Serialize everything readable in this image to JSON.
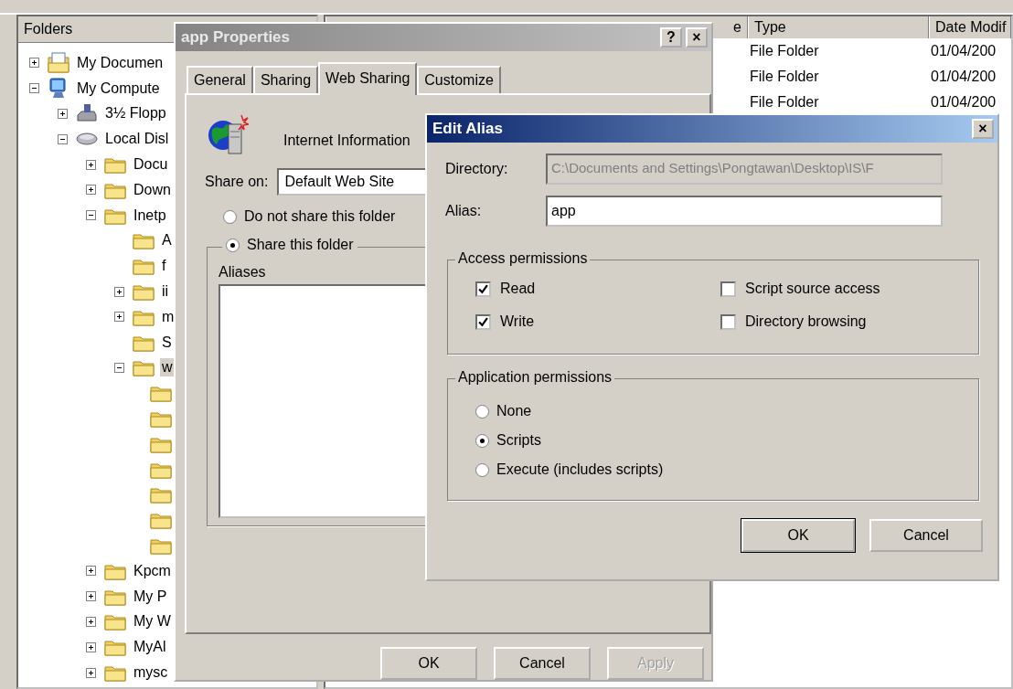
{
  "explorer": {
    "folders_title": "Folders",
    "tree": [
      {
        "label": "My Documen",
        "kind": "documents",
        "expanded": false,
        "selected": false
      },
      {
        "label": "My Compute",
        "kind": "computer",
        "expanded": true,
        "selected": false,
        "children": [
          {
            "label": "3½ Flopp",
            "kind": "floppy",
            "expanded": false,
            "selected": false
          },
          {
            "label": "Local Disl",
            "kind": "disk",
            "expanded": true,
            "selected": false,
            "children": [
              {
                "label": "Docu",
                "kind": "folder",
                "expanded": false,
                "selected": false
              },
              {
                "label": "Down",
                "kind": "folder",
                "expanded": false,
                "selected": false
              },
              {
                "label": "Inetp",
                "kind": "folder",
                "expanded": true,
                "selected": false,
                "children": [
                  {
                    "label": "A",
                    "kind": "folder",
                    "selected": false
                  },
                  {
                    "label": "f",
                    "kind": "folder",
                    "selected": false
                  },
                  {
                    "label": "ii",
                    "kind": "folder",
                    "expanded": false,
                    "selected": false
                  },
                  {
                    "label": "m",
                    "kind": "folder",
                    "expanded": false,
                    "selected": false
                  },
                  {
                    "label": "S",
                    "kind": "folder",
                    "selected": false
                  },
                  {
                    "label": "w",
                    "kind": "folder",
                    "expanded": true,
                    "selected": true,
                    "children": [
                      {
                        "kind": "folder",
                        "selected": false
                      },
                      {
                        "kind": "folder",
                        "selected": false
                      },
                      {
                        "kind": "folder",
                        "selected": false
                      },
                      {
                        "kind": "folder",
                        "selected": false
                      },
                      {
                        "kind": "folder",
                        "selected": false
                      },
                      {
                        "kind": "folder",
                        "selected": false
                      },
                      {
                        "kind": "folder",
                        "selected": false
                      }
                    ]
                  }
                ]
              },
              {
                "label": "Kpcm",
                "kind": "folder",
                "expanded": false,
                "selected": false
              },
              {
                "label": "My P",
                "kind": "folder",
                "expanded": false,
                "selected": false
              },
              {
                "label": "My W",
                "kind": "folder",
                "expanded": false,
                "selected": false
              },
              {
                "label": "MyAl",
                "kind": "folder",
                "expanded": false,
                "selected": false
              },
              {
                "label": "mysc",
                "kind": "folder",
                "expanded": false,
                "selected": false
              }
            ]
          }
        ]
      }
    ],
    "columns": [
      "e",
      "Type",
      "Date Modif"
    ],
    "rows": [
      {
        "type": "File Folder",
        "date": "01/04/200"
      },
      {
        "type": "File Folder",
        "date": "01/04/200"
      },
      {
        "type": "File Folder",
        "date": "01/04/200"
      }
    ]
  },
  "properties": {
    "title": "app Properties",
    "help": "?",
    "close": "×",
    "tabs": [
      {
        "label": "General",
        "selected": false
      },
      {
        "label": "Sharing",
        "selected": false
      },
      {
        "label": "Web Sharing",
        "selected": true
      },
      {
        "label": "Customize",
        "selected": false
      }
    ],
    "service": "Internet Information",
    "share_on_label": "Share on:",
    "share_on_value": "Default Web Site",
    "options": [
      {
        "label": "Do not share this folder",
        "selected": false
      },
      {
        "label": "Share this folder",
        "selected": true
      }
    ],
    "aliases_label": "Aliases",
    "buttons": [
      {
        "label": "OK",
        "disabled": false
      },
      {
        "label": "Cancel",
        "disabled": false
      },
      {
        "label": "Apply",
        "disabled": true
      }
    ]
  },
  "edit_alias": {
    "title": "Edit Alias",
    "close": "×",
    "directory_label": "Directory:",
    "directory_value": "C:\\Documents and Settings\\Pongtawan\\Desktop\\IS\\F",
    "alias_label": "Alias:",
    "alias_value": "app",
    "access_title": "Access permissions",
    "access": [
      {
        "label": "Read",
        "checked": true
      },
      {
        "label": "Script source access",
        "checked": false
      },
      {
        "label": "Write",
        "checked": true
      },
      {
        "label": "Directory browsing",
        "checked": false
      }
    ],
    "app_title": "Application permissions",
    "app_options": [
      {
        "label": "None",
        "selected": false
      },
      {
        "label": "Scripts",
        "selected": true
      },
      {
        "label": "Execute (includes scripts)",
        "selected": false
      }
    ],
    "buttons": [
      {
        "label": "OK",
        "default": true
      },
      {
        "label": "Cancel",
        "default": false
      }
    ]
  }
}
